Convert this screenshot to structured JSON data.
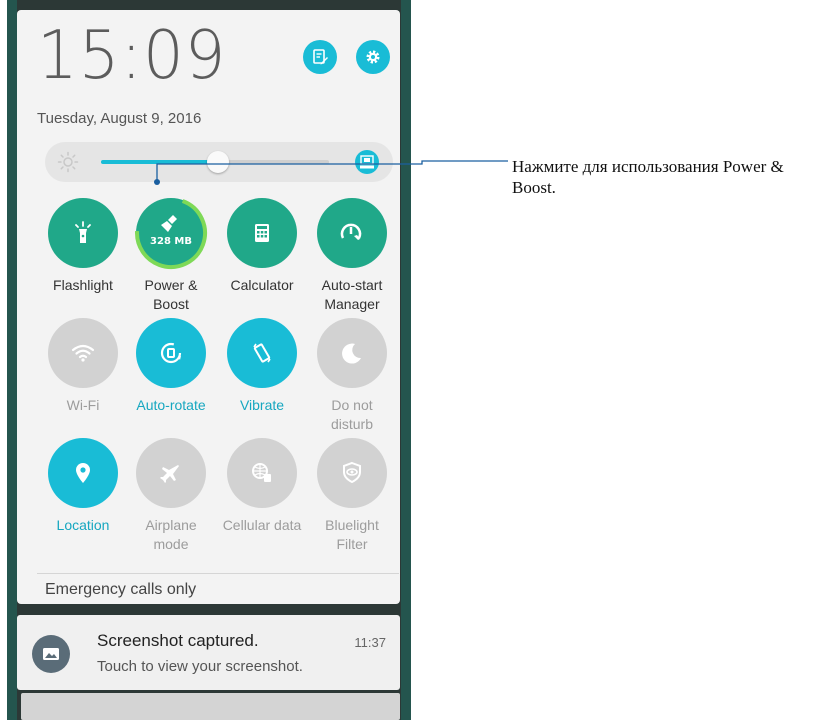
{
  "status": {
    "time": "15:09",
    "date": "Tuesday, August 9, 2016"
  },
  "header_buttons": [
    {
      "icon": "edit-icon"
    },
    {
      "icon": "gear-icon"
    }
  ],
  "brightness": {
    "level": 0.5,
    "auto_icon": "auto-brightness-icon"
  },
  "tiles": [
    {
      "label": "Flashlight",
      "icon": "flashlight-icon",
      "state": "on"
    },
    {
      "label": "Power &\nBoost",
      "icon": "broom-icon",
      "state": "on",
      "badge": "328 MB"
    },
    {
      "label": "Calculator",
      "icon": "calculator-icon",
      "state": "on"
    },
    {
      "label": "Auto-start\nManager",
      "icon": "speedometer-wrench-icon",
      "state": "on"
    },
    {
      "label": "Wi-Fi",
      "icon": "wifi-icon",
      "state": "off"
    },
    {
      "label": "Auto-rotate",
      "icon": "rotate-icon",
      "state": "active"
    },
    {
      "label": "Vibrate",
      "icon": "vibrate-icon",
      "state": "active"
    },
    {
      "label": "Do not\ndisturb",
      "icon": "moon-icon",
      "state": "off"
    },
    {
      "label": "Location",
      "icon": "location-pin-icon",
      "state": "active"
    },
    {
      "label": "Airplane\nmode",
      "icon": "airplane-icon",
      "state": "off"
    },
    {
      "label": "Cellular data",
      "icon": "cellular-data-icon",
      "state": "off"
    },
    {
      "label": "Bluelight\nFilter",
      "icon": "eye-shield-icon",
      "state": "off"
    }
  ],
  "network_status": "Emergency calls only",
  "notification": {
    "title": "Screenshot captured.",
    "time": "11:37",
    "text": "Touch to view your screenshot.",
    "icon": "image-icon"
  },
  "callout": {
    "text": "Нажмите для использования Power & Boost."
  },
  "colors": {
    "accent_cyan": "#19bcd6",
    "accent_green": "#20a889",
    "inactive_grey": "#d2d2d2"
  }
}
